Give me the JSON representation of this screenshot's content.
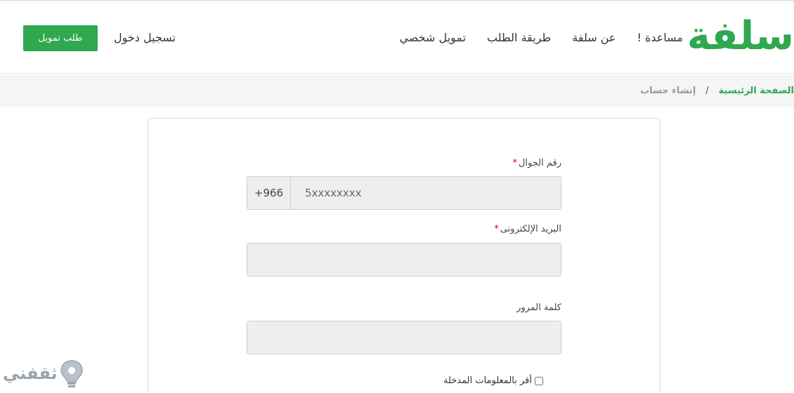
{
  "header": {
    "logo_text": "سلفة",
    "nav": [
      {
        "label": "تمويل شخصي"
      },
      {
        "label": "طريقة الطلب"
      },
      {
        "label": "عن سلفة"
      },
      {
        "label": "مساعدة !"
      }
    ],
    "login_label": "تسجيل دخول",
    "cta_label": "طلب تمويل"
  },
  "breadcrumb": {
    "home": "الصفحة الرئيسية",
    "separator": "/",
    "current": "إنشاء حساب"
  },
  "form": {
    "phone_label": "رقم الجوال",
    "phone_prefix": "+966",
    "phone_placeholder": "5xxxxxxxx",
    "email_label": "البريد الإلكترونى",
    "password_label": "كلمة المرور",
    "required_mark": "*",
    "agree_label": "أقر بالمعلومات المدخلة"
  },
  "colors": {
    "brand": "#2fa84f",
    "required": "#d0021b"
  }
}
